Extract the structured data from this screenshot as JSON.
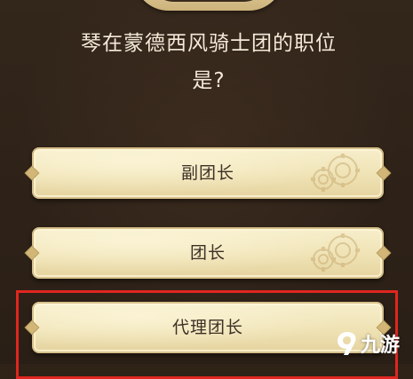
{
  "question": {
    "line1": "琴在蒙德西风骑士团的职位",
    "line2": "是?"
  },
  "options": [
    {
      "label": "副团长"
    },
    {
      "label": "团长"
    },
    {
      "label": "代理团长"
    }
  ],
  "highlighted_option": "代理团长",
  "watermark": {
    "text": "九游",
    "icon": "nine-game-logo-icon"
  },
  "colors": {
    "background": "#2f2217",
    "option_fill": "#f1e5b9",
    "question_text": "#f3ead8",
    "option_text": "#3d3026",
    "highlight_border": "#e0261f"
  }
}
